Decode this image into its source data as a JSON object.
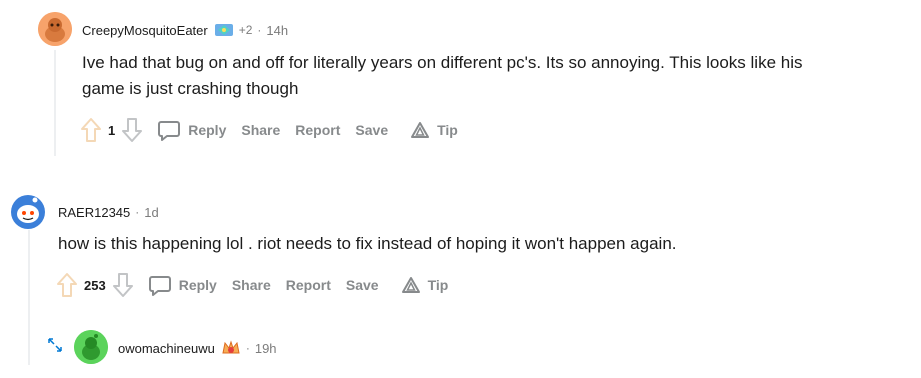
{
  "comments": [
    {
      "username": "CreepyMosquitoEater",
      "flair_count": "+2",
      "separator": "·",
      "time": "14h",
      "body_line1": "Ive had that bug on and off for literally years on different pc's. Its so annoying. This looks like his",
      "body_line2": "game is just crashing though",
      "score": "1"
    },
    {
      "username": "RAER12345",
      "separator": "·",
      "time": "1d",
      "body_line1": "how is this happening lol . riot needs to fix instead of hoping it won't happen again.",
      "score": "253"
    },
    {
      "username": "owomachineuwu",
      "separator": "·",
      "time": "19h"
    }
  ],
  "actions": {
    "reply": "Reply",
    "share": "Share",
    "report": "Report",
    "save": "Save",
    "tip": "Tip"
  },
  "icons": {
    "upvote": "upvote-arrow-icon",
    "downvote": "downvote-arrow-icon",
    "reply": "speech-bubble-icon",
    "tip": "tip-triangle-icon",
    "expand": "expand-arrows-icon"
  },
  "colors": {
    "upvote_highlight": "#f4d8b6",
    "action_gray": "#878a8c",
    "meta_gray": "#7c7c7c",
    "thread_line": "#edeff1",
    "avatar_orange": "#f7a36b",
    "avatar_blue": "#3b7fd9",
    "avatar_green": "#5bd35b"
  }
}
